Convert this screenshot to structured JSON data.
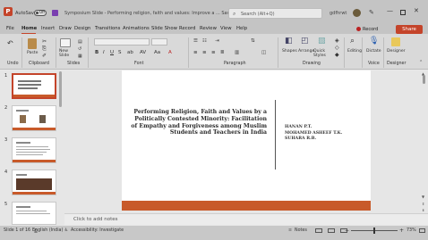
{
  "titlebar": {
    "autosave_label": "AutoSave",
    "autosave_state": "Off",
    "doc_title": "Symposium Slide - Performing religion, faith and values: Improve a ... Saved to this PC",
    "search_placeholder": "Search (Alt+Q)",
    "user_name": "gdfhrwt"
  },
  "menu": {
    "items": [
      "File",
      "Home",
      "Insert",
      "Draw",
      "Design",
      "Transitions",
      "Animations",
      "Slide Show",
      "Record",
      "Review",
      "View",
      "Help"
    ],
    "record_label": "Record",
    "share_label": "Share"
  },
  "ribbon": {
    "undo_label": "Undo",
    "clipboard_label": "Clipboard",
    "paste_label": "Paste",
    "new_slide_label": "New Slide",
    "slides_label": "Slides",
    "font_label": "Font",
    "paragraph_label": "Paragraph",
    "drawing_label": "Drawing",
    "shapes_label": "Shapes",
    "arrange_label": "Arrange",
    "quick_styles_label": "Quick Styles",
    "editing_label": "Editing",
    "dictate_label": "Dictate",
    "voice_label": "Voice",
    "designer_label": "Designer",
    "designer_group_label": "Designer"
  },
  "thumbnails": {
    "numbers": [
      "1",
      "2",
      "3",
      "4",
      "5"
    ]
  },
  "slide": {
    "title": "Performing Religion, Faith and Values by a Politically Contested Minority: Facilitation of Empathy and Forgiveness among Muslim Students and Teachers in India",
    "author_1": "HANAN P.T.",
    "author_2": "MOHAMED ASHEEF T.K.",
    "author_3": "SUHARA R.B."
  },
  "notes": {
    "placeholder": "Click to add notes"
  },
  "status": {
    "slide_count": "Slide 1 of 16",
    "language": "English (India)",
    "accessibility": "Accessibility: Investigate",
    "notes_label": "Notes",
    "zoom": "73%"
  }
}
